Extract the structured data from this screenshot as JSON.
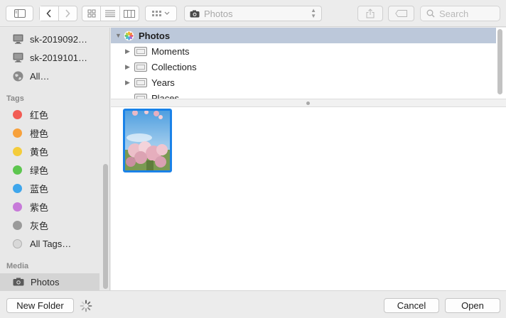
{
  "toolbar": {
    "location": "Photos",
    "search_placeholder": "Search"
  },
  "sidebar": {
    "devices": [
      {
        "label": "sk-2019092…",
        "icon": "computer-icon"
      },
      {
        "label": "sk-2019101…",
        "icon": "computer-icon"
      },
      {
        "label": "All…",
        "icon": "network-globe-icon"
      }
    ],
    "tags_heading": "Tags",
    "tags": [
      {
        "label": "红色",
        "color": "#f25c54"
      },
      {
        "label": "橙色",
        "color": "#f7a13c"
      },
      {
        "label": "黄色",
        "color": "#f4cc3b"
      },
      {
        "label": "绿色",
        "color": "#5dc64f"
      },
      {
        "label": "蓝色",
        "color": "#3ea6ec"
      },
      {
        "label": "紫色",
        "color": "#c77ad9"
      },
      {
        "label": "灰色",
        "color": "#9a9a9a"
      }
    ],
    "all_tags": "All Tags…",
    "media_heading": "Media",
    "media_item": "Photos"
  },
  "browser": {
    "root": "Photos",
    "items": [
      "Moments",
      "Collections",
      "Years",
      "Places"
    ]
  },
  "footer": {
    "new_folder": "New Folder",
    "cancel": "Cancel",
    "open": "Open"
  },
  "colors": {
    "selection_header": "#bcc8da",
    "thumbnail_border": "#1a82e8"
  }
}
